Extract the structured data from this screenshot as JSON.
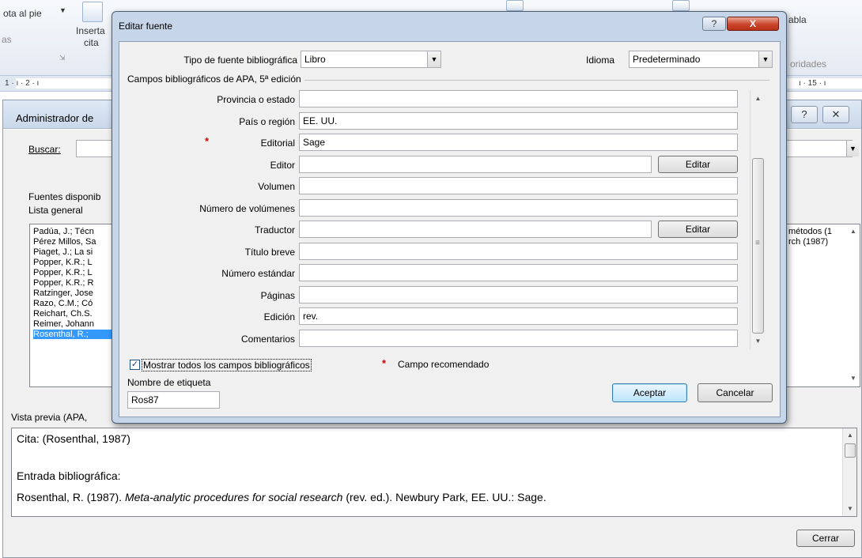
{
  "ribbon": {
    "footnote_label": "ota al pie",
    "left_group": "as",
    "insert_cite_line1": "Inserta",
    "insert_cite_line2": "cita",
    "table_label": "abla",
    "authorities_label": "oridades"
  },
  "ruler": {
    "left_marks": "1 · ı · 2 · ı",
    "right_marks": "ı · 15 · ı"
  },
  "source_manager": {
    "title": "Administrador de",
    "search_label": "Buscar:",
    "available_label": "Fuentes disponib",
    "master_list_label": "Lista general",
    "sources": [
      "Padúa, J.; Técn",
      "Pérez Millos, Sa",
      "Piaget, J.; La si",
      "Popper, K.R.; L",
      "Popper, K.R.; L",
      "Popper, K.R.; R",
      "Ratzinger, Jose",
      "Razo, C.M.; Có",
      "Reichart, Ch.S.",
      "Reimer, Johann",
      "Rosenthal, R.;"
    ],
    "selected_index": 10,
    "right_list_line1": "métodos (1",
    "right_list_line2": "rch  (1987)",
    "preview_label": "Vista previa (APA,",
    "preview_cite": "Cita:  (Rosenthal, 1987)",
    "preview_entry_label": "Entrada bibliográfica:",
    "preview_entry_prefix": "Rosenthal, R. (1987). ",
    "preview_entry_title": "Meta-analytic procedures for social research",
    "preview_entry_suffix": " (rev. ed.). Newbury Park, EE. UU.: Sage.",
    "close_button": "Cerrar"
  },
  "dialog": {
    "title": "Editar fuente",
    "help_glyph": "?",
    "close_glyph": "X",
    "source_type_label": "Tipo de fuente bibliográfica",
    "source_type_value": "Libro",
    "language_label": "Idioma",
    "language_value": "Predeterminado",
    "group_label": "Campos bibliográficos de APA, 5ª edición",
    "fields": {
      "state": {
        "label": "Provincia o estado",
        "value": ""
      },
      "country": {
        "label": "País o región",
        "value": "EE. UU."
      },
      "publisher": {
        "label": "Editorial",
        "value": "Sage"
      },
      "editor": {
        "label": "Editor",
        "value": ""
      },
      "volume": {
        "label": "Volumen",
        "value": ""
      },
      "num_volumes": {
        "label": "Número de volúmenes",
        "value": ""
      },
      "translator": {
        "label": "Traductor",
        "value": ""
      },
      "short_title": {
        "label": "Título breve",
        "value": ""
      },
      "standard_number": {
        "label": "Número estándar",
        "value": ""
      },
      "pages": {
        "label": "Páginas",
        "value": ""
      },
      "edition": {
        "label": "Edición",
        "value": "rev."
      },
      "comments": {
        "label": "Comentarios",
        "value": ""
      }
    },
    "edit_button": "Editar",
    "required_star": "*",
    "show_all_label": "Mostrar todos los campos bibliográficos",
    "show_all_checked": true,
    "recommended_label": "Campo recomendado",
    "tag_name_label": "Nombre de etiqueta",
    "tag_name_value": "Ros87",
    "ok_button": "Aceptar",
    "cancel_button": "Cancelar"
  }
}
